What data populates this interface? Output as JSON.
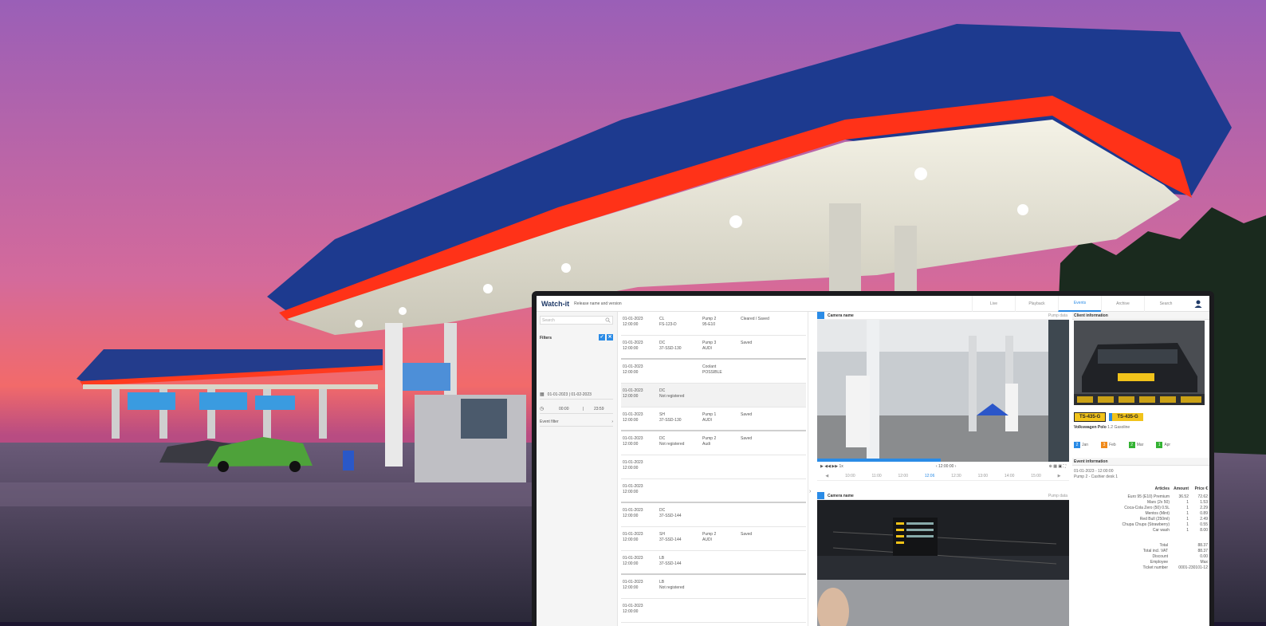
{
  "app": {
    "logo": "Watch-it",
    "subtitle": "Release name and version"
  },
  "nav": {
    "tabs": [
      "Live",
      "Playback",
      "Events",
      "Archive",
      "Search"
    ],
    "active_tab": "Events"
  },
  "filter_panel": {
    "search_placeholder": "Search",
    "filters_label": "Filters",
    "date_range": "01-01-2023 | 01-02-2023",
    "time_from": "00:00",
    "time_to": "23:59",
    "event_filter": "Event filter"
  },
  "events": [
    {
      "date": "01-01-2023",
      "time": "12:00:00",
      "type": "CL",
      "plate": "FS-123-D",
      "pump": "Pump 2",
      "fuel": "95-E10",
      "status": "Cleared / Saved"
    },
    {
      "date": "01-01-2023",
      "time": "12:00:00",
      "type": "DC",
      "plate": "37-SSD-130",
      "pump": "Pump 3",
      "fuel": "AUDI",
      "status": "Saved"
    },
    {
      "date": "01-01-2023",
      "time": "12:00:00",
      "type": "",
      "plate": "",
      "pump": "Coolant",
      "fuel": "POSSIBLE",
      "status": ""
    },
    {
      "date": "01-01-2023",
      "time": "12:00:00",
      "type": "DC",
      "plate": "Not registered",
      "pump": "",
      "fuel": "",
      "status": ""
    },
    {
      "date": "01-01-2023",
      "time": "12:00:00",
      "type": "SH",
      "plate": "37-SSD-130",
      "pump": "Pump 1",
      "fuel": "AUDI",
      "status": "Saved"
    },
    {
      "date": "01-01-2023",
      "time": "12:00:00",
      "type": "DC",
      "plate": "Not registered",
      "pump": "Pump 2",
      "fuel": "Audi",
      "status": "Saved"
    },
    {
      "date": "01-01-2023",
      "time": "12:00:00",
      "type": "",
      "plate": "",
      "pump": "",
      "fuel": "",
      "status": ""
    },
    {
      "date": "01-01-2023",
      "time": "12:00:00",
      "type": "",
      "plate": "",
      "pump": "",
      "fuel": "",
      "status": ""
    },
    {
      "date": "01-01-2023",
      "time": "12:00:00",
      "type": "DC",
      "plate": "37-SSD-144",
      "pump": "",
      "fuel": "",
      "status": ""
    },
    {
      "date": "01-01-2023",
      "time": "12:00:00",
      "type": "SH",
      "plate": "37-SSD-144",
      "pump": "Pump 2",
      "fuel": "AUDI",
      "status": "Saved"
    },
    {
      "date": "01-01-2023",
      "time": "12:00:00",
      "type": "LB",
      "plate": "37-SSD-144",
      "pump": "",
      "fuel": "",
      "status": ""
    },
    {
      "date": "01-01-2023",
      "time": "12:00:00",
      "type": "LB",
      "plate": "Not registered",
      "pump": "",
      "fuel": "",
      "status": ""
    },
    {
      "date": "01-01-2023",
      "time": "12:00:00",
      "type": "",
      "plate": "",
      "pump": "",
      "fuel": "",
      "status": ""
    }
  ],
  "camera1": {
    "title": "Camera name",
    "right": "Pump data"
  },
  "camera2": {
    "title": "Camera name",
    "right": "Pump data"
  },
  "player": {
    "speed": "1x",
    "center_time": "12:00:00",
    "timeline": [
      "10:00",
      "11:00",
      "12:00",
      "12:06",
      "12:30",
      "13:00",
      "14:00",
      "15:00"
    ],
    "active_timeline": "12:06"
  },
  "client": {
    "title": "Client information",
    "plates": [
      "TS-435-G",
      "TS-435-G"
    ],
    "vehicle": "Volkswagen Polo",
    "vehicle_detail": "1.2 Gasoline",
    "badges": [
      {
        "count": "2",
        "label": "Jan",
        "color": "#2a8be6"
      },
      {
        "count": "3",
        "label": "Feb",
        "color": "#f08a1b"
      },
      {
        "count": "2",
        "label": "Mar",
        "color": "#34b233"
      },
      {
        "count": "1",
        "label": "Apr",
        "color": "#34b233"
      }
    ]
  },
  "event_info": {
    "title": "Event information",
    "line1": "01-01-2023 - 12:00:00",
    "line2": "Pump 2 - Cashier desk 1",
    "col_articles": "Articles",
    "col_amount": "Amount",
    "col_price": "Price €",
    "articles": [
      {
        "name": "Euro 95 (E10) Premium",
        "amount": "36.52",
        "price": "72.62"
      },
      {
        "name": "Mars (2x 50)",
        "amount": "1",
        "price": "1.53"
      },
      {
        "name": "Coca-Cola Zero (50) 0.5L",
        "amount": "1",
        "price": "2.29"
      },
      {
        "name": "Mentos (Mint)",
        "amount": "1",
        "price": "0.89"
      },
      {
        "name": "Red Bull (250ml)",
        "amount": "1",
        "price": "2.49"
      },
      {
        "name": "Chupa Chups (Strawberry)",
        "amount": "1",
        "price": "0.55"
      },
      {
        "name": "Car wash",
        "amount": "1",
        "price": "8.00"
      }
    ],
    "totals": [
      {
        "label": "Total",
        "value": "88.37"
      },
      {
        "label": "Total incl. VAT",
        "value": "88.37"
      },
      {
        "label": "Discount",
        "value": "0.00"
      },
      {
        "label": "Employee",
        "value": "Max"
      },
      {
        "label": "Ticket number",
        "value": "0001-230101-12"
      }
    ]
  }
}
